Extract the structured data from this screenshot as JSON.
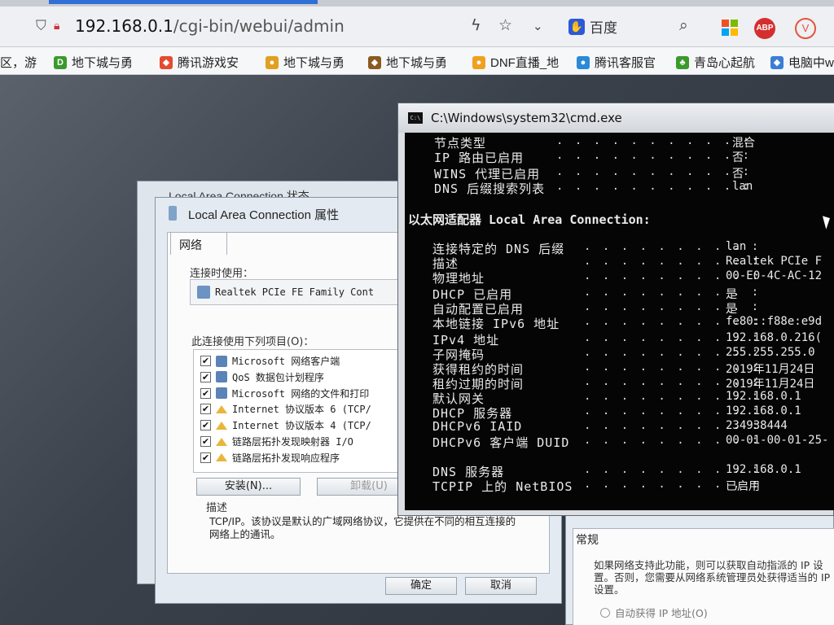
{
  "browser": {
    "url_host": "192.168.0.1",
    "url_path": "/cgi-bin/webui/admin",
    "search_engine": "百度",
    "bookmarks": [
      {
        "label": "区，游",
        "color": "#888888",
        "glyph": ""
      },
      {
        "label": "地下城与勇",
        "color": "#3a9a2c",
        "glyph": "D"
      },
      {
        "label": "腾讯游戏安",
        "color": "#e54b2f",
        "glyph": "◆"
      },
      {
        "label": "地下城与勇",
        "color": "#e0a020",
        "glyph": "●"
      },
      {
        "label": "地下城与勇",
        "color": "#8a5a20",
        "glyph": "◆"
      },
      {
        "label": "DNF直播_地",
        "color": "#f0a020",
        "glyph": "●"
      },
      {
        "label": "腾讯客服官",
        "color": "#2a8ad8",
        "glyph": "●"
      },
      {
        "label": "青岛心起航",
        "color": "#3a9a2c",
        "glyph": "♣"
      },
      {
        "label": "电脑中w",
        "color": "#3b7ed6",
        "glyph": "◆"
      }
    ]
  },
  "dialog_back": {
    "title": "Local Area Connection 状态"
  },
  "dialog": {
    "title": "Local Area Connection 属性",
    "tab": "网络",
    "connect_using_label": "连接时使用：",
    "adapter_name": "Realtek PCIe FE Family Cont",
    "items_label": "此连接使用下列项目(O)：",
    "items": [
      {
        "label": "Microsoft 网络客户端",
        "icon": "network-client-icon"
      },
      {
        "label": "QoS 数据包计划程序",
        "icon": "qos-icon"
      },
      {
        "label": "Microsoft 网络的文件和打印",
        "icon": "file-share-icon"
      },
      {
        "label": "Internet 协议版本 6 (TCP/",
        "icon": "protocol-icon"
      },
      {
        "label": "Internet 协议版本 4 (TCP/",
        "icon": "protocol-icon"
      },
      {
        "label": "链路层拓扑发现映射器 I/O",
        "icon": "protocol-icon"
      },
      {
        "label": "链路层拓扑发现响应程序",
        "icon": "protocol-icon"
      }
    ],
    "install_button": "安装(N)...",
    "uninstall_button": "卸载(U)",
    "description_title": "描述",
    "description_text": "TCP/IP。该协议是默认的广域网络协议，它提供在不同的相互连接的网络上的通讯。",
    "ok_button": "确定",
    "cancel_button": "取消"
  },
  "dialog_right": {
    "tab": "常规",
    "text": "如果网络支持此功能，则可以获取自动指派的 IP 设置。否则，您需要从网络系统管理员处获得适当的 IP 设置。",
    "radio_auto_ip": "自动获得 IP 地址(O)"
  },
  "cmd": {
    "title": "C:\\Windows\\system32\\cmd.exe",
    "top_lines": [
      {
        "key": "节点类型",
        "value": "混合"
      },
      {
        "key": "IP 路由已启用",
        "value": "否"
      },
      {
        "key": "WINS 代理已启用",
        "value": "否"
      },
      {
        "key": "DNS 后缀搜索列表",
        "value": "lan"
      }
    ],
    "adapter_header": "以太网适配器 Local Area Connection:",
    "lines": [
      {
        "key": "连接特定的 DNS 后缀",
        "value": "lan"
      },
      {
        "key": "描述",
        "value": "Realtek PCIe F"
      },
      {
        "key": "物理地址",
        "value": "00-E0-4C-AC-12"
      },
      {
        "key": "DHCP 已启用",
        "value": "是"
      },
      {
        "key": "自动配置已启用",
        "value": "是"
      },
      {
        "key": "本地链接 IPv6 地址",
        "value": "fe80::f88e:e9d"
      },
      {
        "key": "IPv4 地址",
        "value": "192.168.0.216("
      },
      {
        "key": "子网掩码",
        "value": "255.255.255.0"
      },
      {
        "key": "获得租约的时间",
        "value": "2019年11月24日"
      },
      {
        "key": "租约过期的时间",
        "value": "2019年11月24日"
      },
      {
        "key": "默认网关",
        "value": "192.168.0.1"
      },
      {
        "key": "DHCP 服务器",
        "value": "192.168.0.1"
      },
      {
        "key": "DHCPv6 IAID",
        "value": "234938444"
      },
      {
        "key": "DHCPv6 客户端 DUID",
        "value": "00-01-00-01-25-"
      },
      {
        "key": "DNS 服务器",
        "value": "192.168.0.1"
      },
      {
        "key": "TCPIP 上的 NetBIOS",
        "value": "已启用"
      }
    ]
  }
}
